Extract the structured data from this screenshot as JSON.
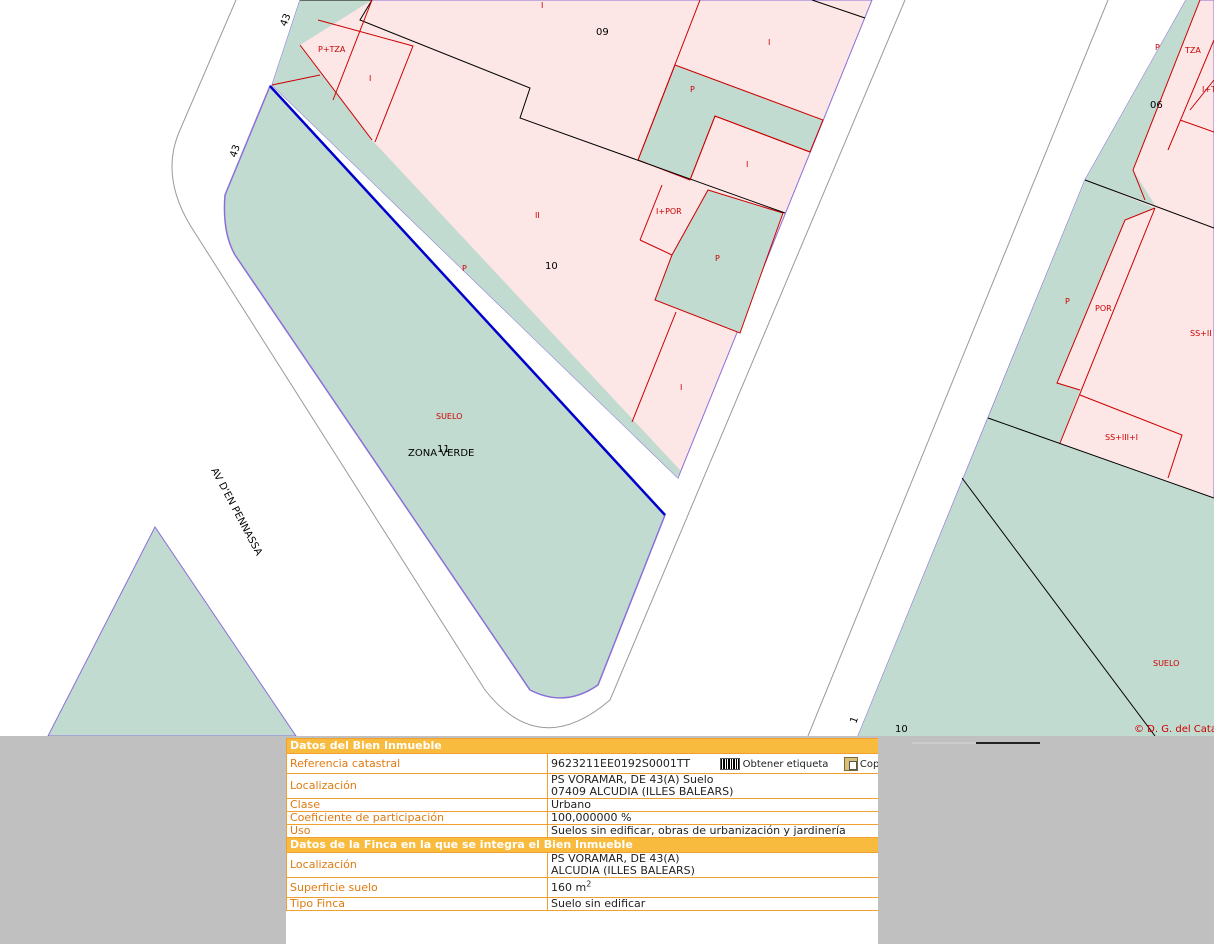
{
  "map": {
    "street_label": "AV D'EN PENNASSA",
    "parcel_numbers": [
      "09",
      "10",
      "11",
      "06",
      "10"
    ],
    "street_numbers": [
      "43",
      "43",
      "1"
    ],
    "zone_label": "ZONA VERDE",
    "unit_labels": [
      "P+TZA",
      "I",
      "I",
      "I",
      "P",
      "I",
      "II",
      "I+POR",
      "P",
      "P",
      "I",
      "SUELO",
      "P",
      "TZA",
      "I+T",
      "P",
      "POR",
      "SS+II",
      "SS+III+I",
      "SUELO"
    ],
    "copyright": "© D. G. del Cata",
    "colors": {
      "built": "#fde6e6",
      "green": "#c2dbd1",
      "selected_outline": "#0000cc",
      "parcel_line": "#cc0000",
      "boundary": "#8a6fd8"
    }
  },
  "inmueble": {
    "title": "Datos del Bien Inmueble",
    "ref_label": "Referencia catastral",
    "ref_value": "9623211EE0192S0001TT",
    "ref_action": "Obtener etiqueta",
    "ref_copy": "Cop",
    "loc_label": "Localización",
    "loc_line1": "PS VORAMAR, DE 43(A) Suelo",
    "loc_line2": "07409 ALCUDIA (ILLES BALEARS)",
    "clase_label": "Clase",
    "clase_value": "Urbano",
    "coef_label": "Coeficiente de participación",
    "coef_value": "100,000000 %",
    "uso_label": "Uso",
    "uso_value": "Suelos sin edificar, obras de urbanización y jardinería"
  },
  "finca": {
    "title": "Datos de la Finca en la que se integra el Bien Inmueble",
    "loc_label": "Localización",
    "loc_line1": "PS VORAMAR, DE 43(A)",
    "loc_line2": "ALCUDIA (ILLES BALEARS)",
    "sup_label": "Superficie suelo",
    "sup_value": "160 m",
    "sup_unit_exp": "2",
    "tipo_label": "Tipo Finca",
    "tipo_value": "Suelo sin edificar"
  }
}
